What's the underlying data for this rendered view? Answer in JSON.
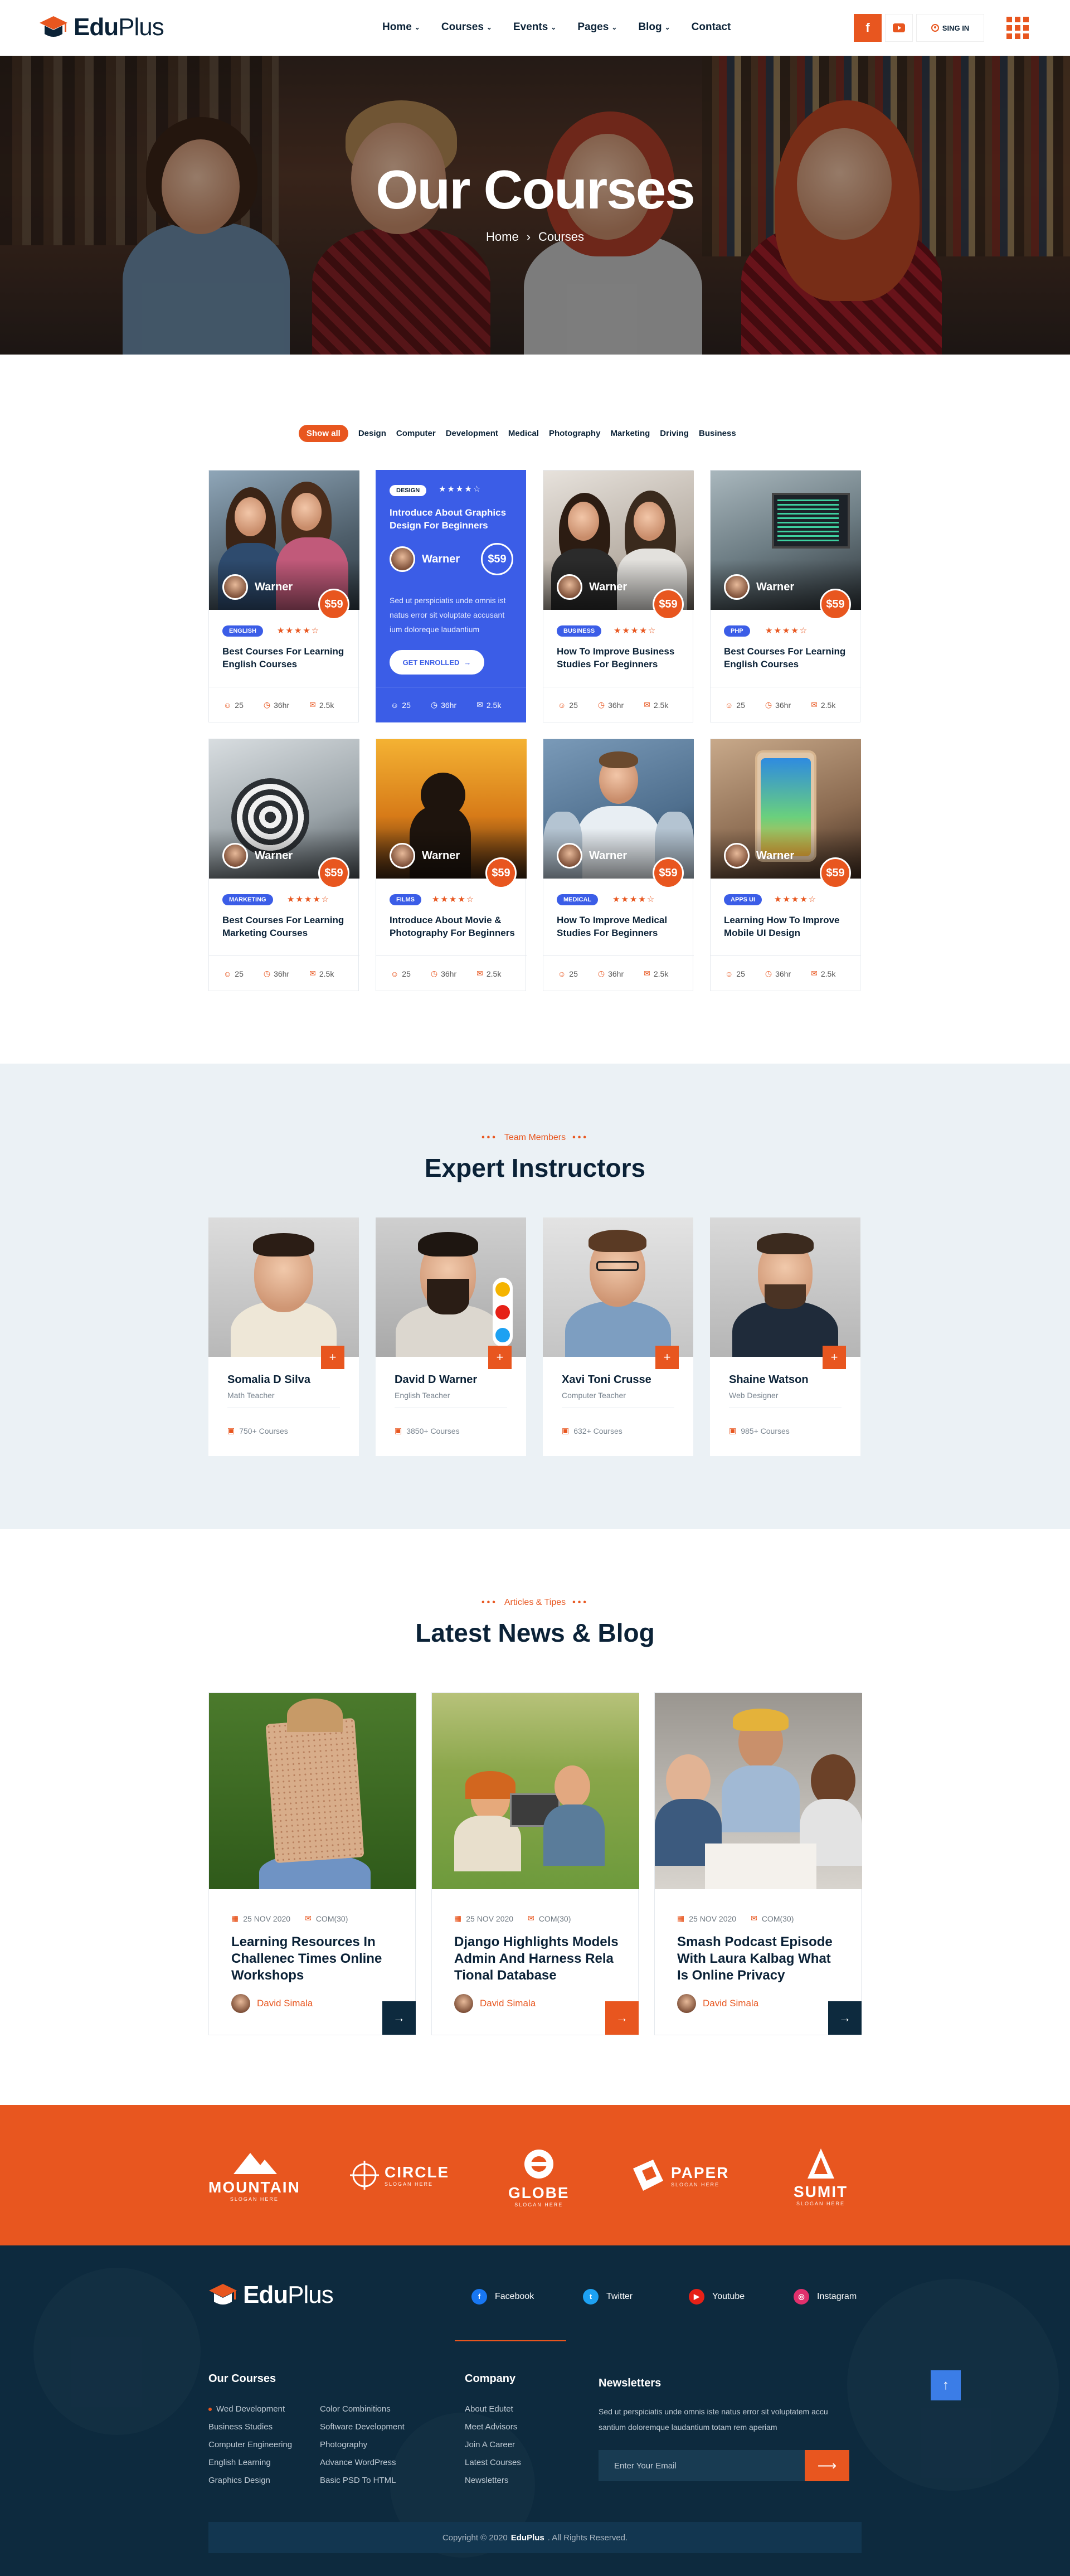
{
  "header": {
    "logo_bold": "Edu",
    "logo_light": "Plus",
    "nav": [
      {
        "label": "Home",
        "dropdown": true
      },
      {
        "label": "Courses",
        "dropdown": true
      },
      {
        "label": "Events",
        "dropdown": true
      },
      {
        "label": "Pages",
        "dropdown": true
      },
      {
        "label": "Blog",
        "dropdown": true
      },
      {
        "label": "Contact",
        "dropdown": false
      }
    ],
    "facebook_glyph": "f",
    "signin_label": "SING IN"
  },
  "hero": {
    "title": "Our Courses",
    "breadcrumb_home": "Home",
    "breadcrumb_sep": "›",
    "breadcrumb_current": "Courses"
  },
  "filters": [
    "Show all",
    "Design",
    "Computer",
    "Development",
    "Medical",
    "Photography",
    "Marketing",
    "Driving",
    "Business"
  ],
  "courses": [
    {
      "author": "Warner",
      "price": "$59",
      "tag": "ENGLISH",
      "title": "Best Courses For Learning English Courses",
      "students": "25",
      "duration": "36hr",
      "comments": "2.5k"
    },
    {
      "author": "Warner",
      "price": "$59",
      "tag": "DESIGN",
      "title": "Introduce About Graphics Design For Beginners",
      "desc": "Sed ut perspiciatis unde omnis ist natus error sit voluptate accusant ium doloreque laudantium",
      "cta": "GET ENROLLED",
      "students": "25",
      "duration": "36hr",
      "comments": "2.5k"
    },
    {
      "author": "Warner",
      "price": "$59",
      "tag": "BUSINESS",
      "title": "How To Improve Business Studies For Beginners",
      "students": "25",
      "duration": "36hr",
      "comments": "2.5k"
    },
    {
      "author": "Warner",
      "price": "$59",
      "tag": "PHP",
      "title": "Best Courses For Learning English Courses",
      "students": "25",
      "duration": "36hr",
      "comments": "2.5k"
    },
    {
      "author": "Warner",
      "price": "$59",
      "tag": "MARKETING",
      "title": "Best Courses For Learning Marketing Courses",
      "students": "25",
      "duration": "36hr",
      "comments": "2.5k"
    },
    {
      "author": "Warner",
      "price": "$59",
      "tag": "FILMS",
      "title": "Introduce About Movie & Photography For Beginners",
      "students": "25",
      "duration": "36hr",
      "comments": "2.5k"
    },
    {
      "author": "Warner",
      "price": "$59",
      "tag": "MEDICAL",
      "title": "How To Improve Medical Studies For Beginners",
      "students": "25",
      "duration": "36hr",
      "comments": "2.5k"
    },
    {
      "author": "Warner",
      "price": "$59",
      "tag": "APPS UI",
      "title": "Learning How To Improve Mobile UI Design",
      "students": "25",
      "duration": "36hr",
      "comments": "2.5k"
    }
  ],
  "rating_stars": "★★★★☆",
  "instructors": {
    "subtitle": "Team Members",
    "title": "Expert Instructors",
    "plus_glyph": "+",
    "items": [
      {
        "name": "Somalia D Silva",
        "role": "Math Teacher",
        "courses": "750+ Courses"
      },
      {
        "name": "David D Warner",
        "role": "English Teacher",
        "courses": "3850+ Courses"
      },
      {
        "name": "Xavi Toni Crusse",
        "role": "Computer Teacher",
        "courses": "632+ Courses"
      },
      {
        "name": "Shaine Watson",
        "role": "Web Designer",
        "courses": "985+ Courses"
      }
    ]
  },
  "blog": {
    "subtitle": "Articles & Tipes",
    "title": "Latest News & Blog",
    "posts": [
      {
        "date": "25 NOV 2020",
        "comments": "COM(30)",
        "title": "Learning Resources In Challenec Times Online Workshops",
        "author": "David Simala"
      },
      {
        "date": "25 NOV 2020",
        "comments": "COM(30)",
        "title": "Django Highlights Models Admin And Harness Rela Tional Database",
        "author": "David Simala"
      },
      {
        "date": "25 NOV 2020",
        "comments": "COM(30)",
        "title": "Smash Podcast Episode With Laura Kalbag What Is Online Privacy",
        "author": "David Simala"
      }
    ]
  },
  "partners": [
    {
      "name": "MOUNTAIN",
      "slogan": "SLOGAN HERE"
    },
    {
      "name": "CIRCLE",
      "slogan": "SLOGAN HERE"
    },
    {
      "name": "GLOBE",
      "slogan": "SLOGAN HERE"
    },
    {
      "name": "PAPER",
      "slogan": "SLOGAN HERE"
    },
    {
      "name": "SUMIT",
      "slogan": "SLOGAN HERE"
    }
  ],
  "footer": {
    "logo_bold": "Edu",
    "logo_light": "Plus",
    "social": [
      {
        "label": "Facebook",
        "glyph": "f",
        "color": "#1877f2"
      },
      {
        "label": "Twitter",
        "glyph": "t",
        "color": "#1da1f2"
      },
      {
        "label": "Youtube",
        "glyph": "▶",
        "color": "#e62117"
      },
      {
        "label": "Instagram",
        "glyph": "◎",
        "color": "#e1306c"
      }
    ],
    "courses_title": "Our Courses",
    "courses_col1": [
      "Wed Development",
      "Business Studies",
      "Computer Engineering",
      "English Learning",
      "Graphics Design"
    ],
    "courses_col2": [
      "Color Combinitions",
      "Software Development",
      "Photography",
      "Advance WordPress",
      "Basic PSD To HTML"
    ],
    "company_title": "Company",
    "company_links": [
      "About Edutet",
      "Meet Advisors",
      "Join A Career",
      "Latest Courses",
      "Newsletters"
    ],
    "newsletter_title": "Newsletters",
    "newsletter_text": "Sed ut perspiciatis unde omnis iste natus error sit voluptatem accu santium doloremque laudantium totam rem aperiam",
    "email_placeholder": "Enter Your Email",
    "copyright_pre": "Copyright © 2020",
    "copyright_brand": "EduPlus",
    "copyright_post": ". All Rights Reserved."
  },
  "colors": {
    "accent": "#e8561f",
    "navy": "#0b2237",
    "blue": "#3b5de7",
    "footer_bg": "#0d2a3e"
  }
}
